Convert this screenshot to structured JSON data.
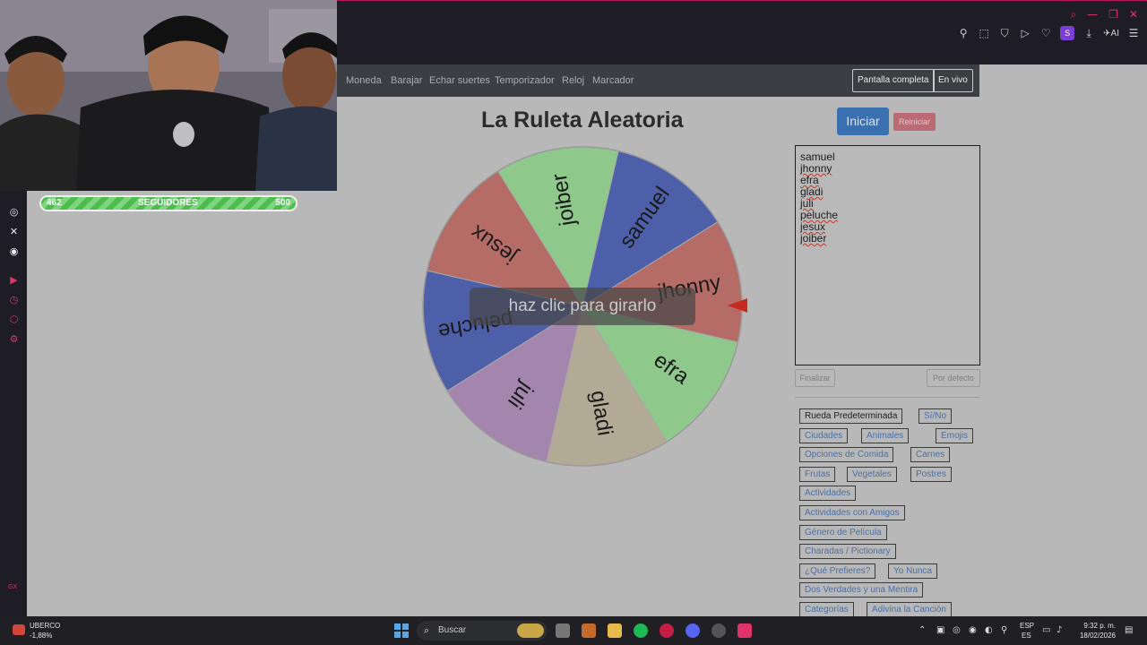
{
  "nav": {
    "links": [
      "Moneda",
      "Barajar",
      "Echar suertes",
      "Temporizador",
      "Reloj",
      "Marcador"
    ],
    "fullscreen": "Pantalla completa",
    "live": "En vivo"
  },
  "title": "La Ruleta Aleatoria",
  "buttons": {
    "start": "Iniciar",
    "reset": "Reiniciar",
    "finalize": "Finalizar",
    "default": "Por defecto"
  },
  "wheel": {
    "hint": "haz clic para girarlo",
    "segments": [
      {
        "label": "samuel",
        "color": "#4d5fa9"
      },
      {
        "label": "jhonny",
        "color": "#b56b66"
      },
      {
        "label": "efra",
        "color": "#8fc88b"
      },
      {
        "label": "gladi",
        "color": "#b3aa96"
      },
      {
        "label": "juli",
        "color": "#a485ae"
      },
      {
        "label": "peluche",
        "color": "#4d5fa9"
      },
      {
        "label": "jesux",
        "color": "#b56b66"
      },
      {
        "label": "joiber",
        "color": "#8fc88b"
      }
    ],
    "pointer_color": "#c62a20"
  },
  "names": [
    "samuel",
    "jhonny",
    "efra",
    "gladi",
    "juli",
    "peluche",
    "jesux",
    "joiber"
  ],
  "presets": [
    "Rueda Predeterminada",
    "Sí/No",
    "Ciudades",
    "Animales",
    "Emojis",
    "Opciones de Comida",
    "Carnes",
    "Frutas",
    "Vegetales",
    "Postres",
    "Actividades",
    "Actividades con Amigos",
    "Género de Película",
    "Charadas / Pictionary",
    "¿Qué Prefieres?",
    "Yo Nunca",
    "Dos Verdades y una Mentira",
    "Categorías",
    "Adivina la Canción"
  ],
  "stream": {
    "followers_current": "462",
    "followers_label": "SEGUIDORES",
    "followers_goal": "500"
  },
  "taskbar": {
    "ticker_name": "UBERCO",
    "ticker_change": "-1,88%",
    "search": "Buscar",
    "lang_top": "ESP",
    "lang_bottom": "ES",
    "time": "9:32 p. m.",
    "date": "18/02/2026"
  },
  "sidebar": {
    "gx": "GX"
  },
  "icons": {
    "browser": [
      "pin-icon",
      "snapshot-icon",
      "shield-icon",
      "play-icon",
      "heart-icon",
      "profile-icon",
      "download-icon",
      "aria-icon",
      "menu-icon"
    ],
    "sidebar": [
      "twitch-icon",
      "instagram-icon",
      "x-icon",
      "discord-icon",
      "player-icon",
      "history-icon",
      "extensions-icon",
      "settings-icon"
    ]
  }
}
